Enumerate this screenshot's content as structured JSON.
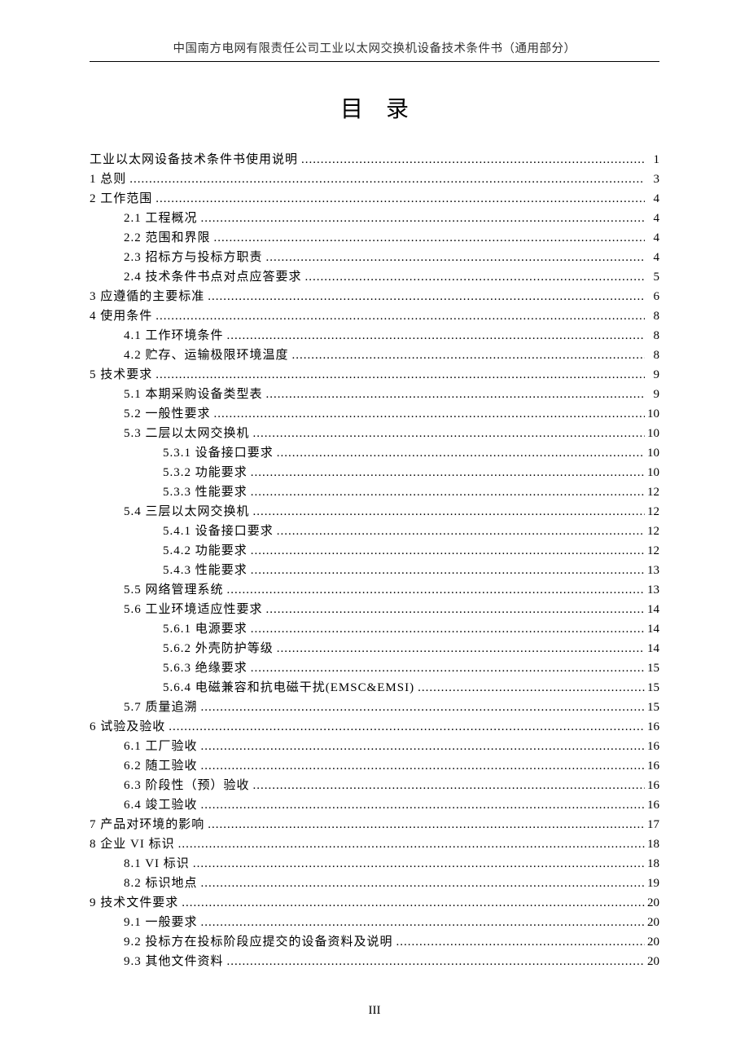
{
  "header": "中国南方电网有限责任公司工业以太网交换机设备技术条件书（通用部分）",
  "title": "目录",
  "footer": "III",
  "toc": [
    {
      "level": 0,
      "label": "工业以太网设备技术条件书使用说明",
      "page": "1"
    },
    {
      "level": 0,
      "label": "1 总则",
      "page": "3"
    },
    {
      "level": 0,
      "label": "2 工作范围",
      "page": "4"
    },
    {
      "level": 1,
      "label": "2.1 工程概况",
      "page": "4"
    },
    {
      "level": 1,
      "label": "2.2 范围和界限",
      "page": "4"
    },
    {
      "level": 1,
      "label": "2.3 招标方与投标方职责",
      "page": "4"
    },
    {
      "level": 1,
      "label": "2.4 技术条件书点对点应答要求",
      "page": "5"
    },
    {
      "level": 0,
      "label": "3 应遵循的主要标准",
      "page": "6"
    },
    {
      "level": 0,
      "label": "4 使用条件",
      "page": "8"
    },
    {
      "level": 1,
      "label": "4.1 工作环境条件",
      "page": "8"
    },
    {
      "level": 1,
      "label": "4.2 贮存、运输极限环境温度",
      "page": "8"
    },
    {
      "level": 0,
      "label": "5 技术要求",
      "page": "9"
    },
    {
      "level": 1,
      "label": "5.1 本期采购设备类型表",
      "page": "9"
    },
    {
      "level": 1,
      "label": "5.2 一般性要求",
      "page": "10"
    },
    {
      "level": 1,
      "label": "5.3 二层以太网交换机",
      "page": "10"
    },
    {
      "level": 2,
      "label": "5.3.1 设备接口要求",
      "page": "10"
    },
    {
      "level": 2,
      "label": "5.3.2 功能要求",
      "page": "10"
    },
    {
      "level": 2,
      "label": "5.3.3 性能要求",
      "page": "12"
    },
    {
      "level": 1,
      "label": "5.4 三层以太网交换机",
      "page": "12"
    },
    {
      "level": 2,
      "label": "5.4.1 设备接口要求",
      "page": "12"
    },
    {
      "level": 2,
      "label": "5.4.2 功能要求",
      "page": "12"
    },
    {
      "level": 2,
      "label": "5.4.3 性能要求",
      "page": "13"
    },
    {
      "level": 1,
      "label": "5.5 网络管理系统",
      "page": "13"
    },
    {
      "level": 1,
      "label": "5.6 工业环境适应性要求",
      "page": "14"
    },
    {
      "level": 2,
      "label": "5.6.1 电源要求",
      "page": "14"
    },
    {
      "level": 2,
      "label": "5.6.2 外壳防护等级",
      "page": "14"
    },
    {
      "level": 2,
      "label": "5.6.3 绝缘要求",
      "page": "15"
    },
    {
      "level": 2,
      "label": "5.6.4 电磁兼容和抗电磁干扰(EMSC&EMSI)",
      "page": "15"
    },
    {
      "level": 1,
      "label": "5.7 质量追溯",
      "page": "15"
    },
    {
      "level": 0,
      "label": "6 试验及验收",
      "page": "16"
    },
    {
      "level": 1,
      "label": "6.1 工厂验收",
      "page": "16"
    },
    {
      "level": 1,
      "label": "6.2 随工验收",
      "page": "16"
    },
    {
      "level": 1,
      "label": "6.3 阶段性（预）验收",
      "page": "16"
    },
    {
      "level": 1,
      "label": "6.4 竣工验收",
      "page": "16"
    },
    {
      "level": 0,
      "label": "7 产品对环境的影响",
      "page": "17"
    },
    {
      "level": 0,
      "label": "8 企业 VI 标识",
      "page": "18"
    },
    {
      "level": 1,
      "label": "8.1 VI 标识",
      "page": "18"
    },
    {
      "level": 1,
      "label": "8.2 标识地点",
      "page": "19"
    },
    {
      "level": 0,
      "label": "9 技术文件要求",
      "page": "20"
    },
    {
      "level": 1,
      "label": "9.1 一般要求",
      "page": "20"
    },
    {
      "level": 1,
      "label": "9.2 投标方在投标阶段应提交的设备资料及说明",
      "page": "20"
    },
    {
      "level": 1,
      "label": "9.3 其他文件资料",
      "page": "20"
    }
  ]
}
